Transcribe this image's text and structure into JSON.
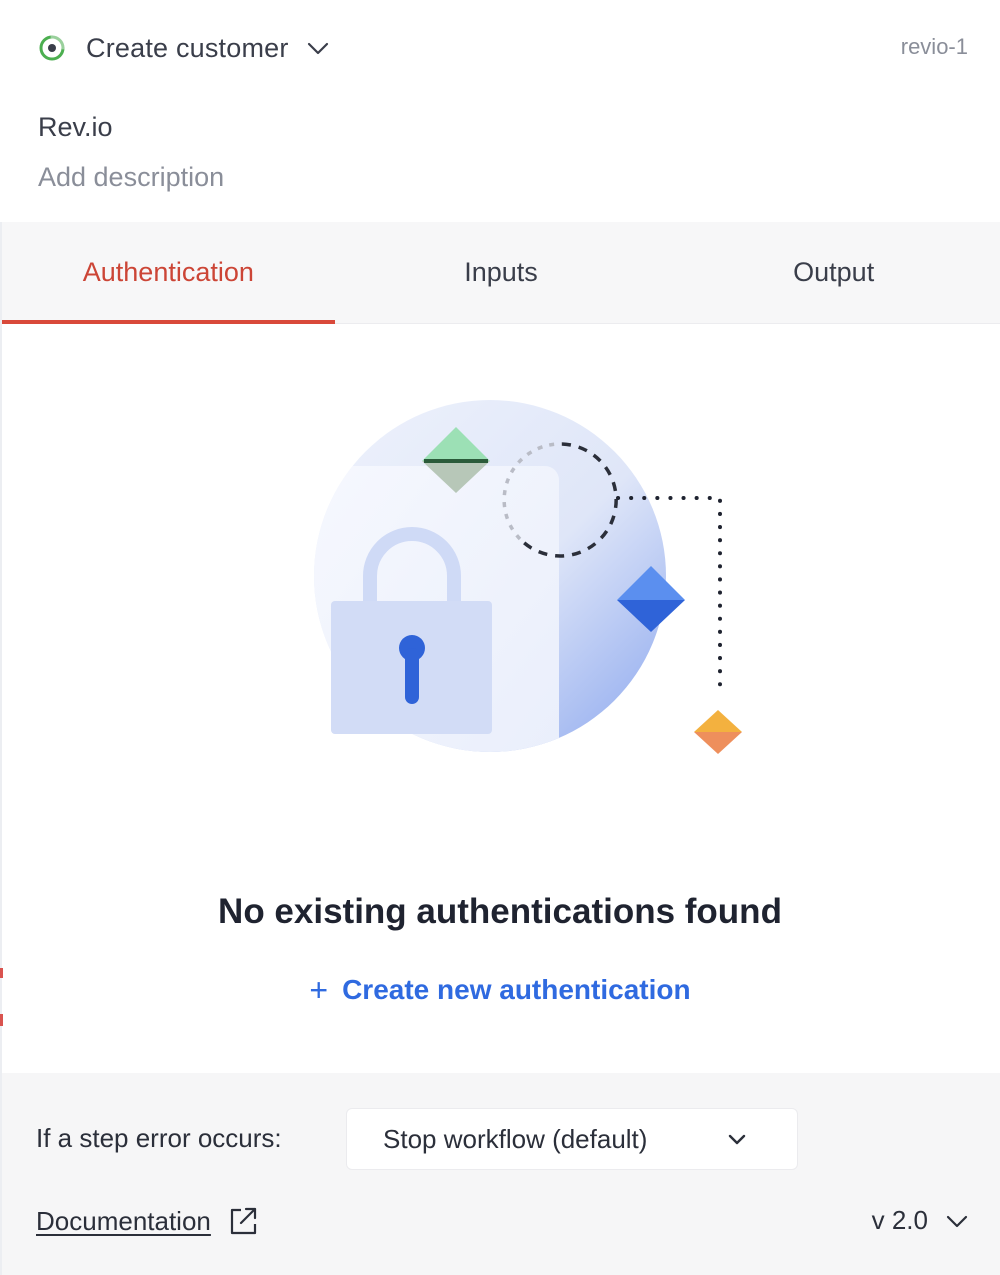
{
  "header": {
    "step_title": "Create customer",
    "step_id": "revio-1",
    "app_name": "Rev.io",
    "description_placeholder": "Add description"
  },
  "tabs": [
    {
      "label": "Authentication",
      "active": true
    },
    {
      "label": "Inputs",
      "active": false
    },
    {
      "label": "Output",
      "active": false
    }
  ],
  "empty_state": {
    "title": "No existing authentications found",
    "action_icon": "+",
    "action_label": "Create new authentication"
  },
  "footer": {
    "error_label": "If a step error occurs:",
    "error_select_value": "Stop workflow (default)",
    "documentation_label": "Documentation",
    "version_label": "v 2.0"
  },
  "icons": {
    "step": "step-status-icon",
    "step_dropdown": "chevron-down-icon",
    "external_link": "external-link-icon",
    "version_dropdown": "chevron-down-icon",
    "illustration": "padlock-illustration"
  },
  "colors": {
    "active_tab": "#cc4536",
    "link": "#2f6ae0",
    "step_icon": "#4caf50"
  }
}
